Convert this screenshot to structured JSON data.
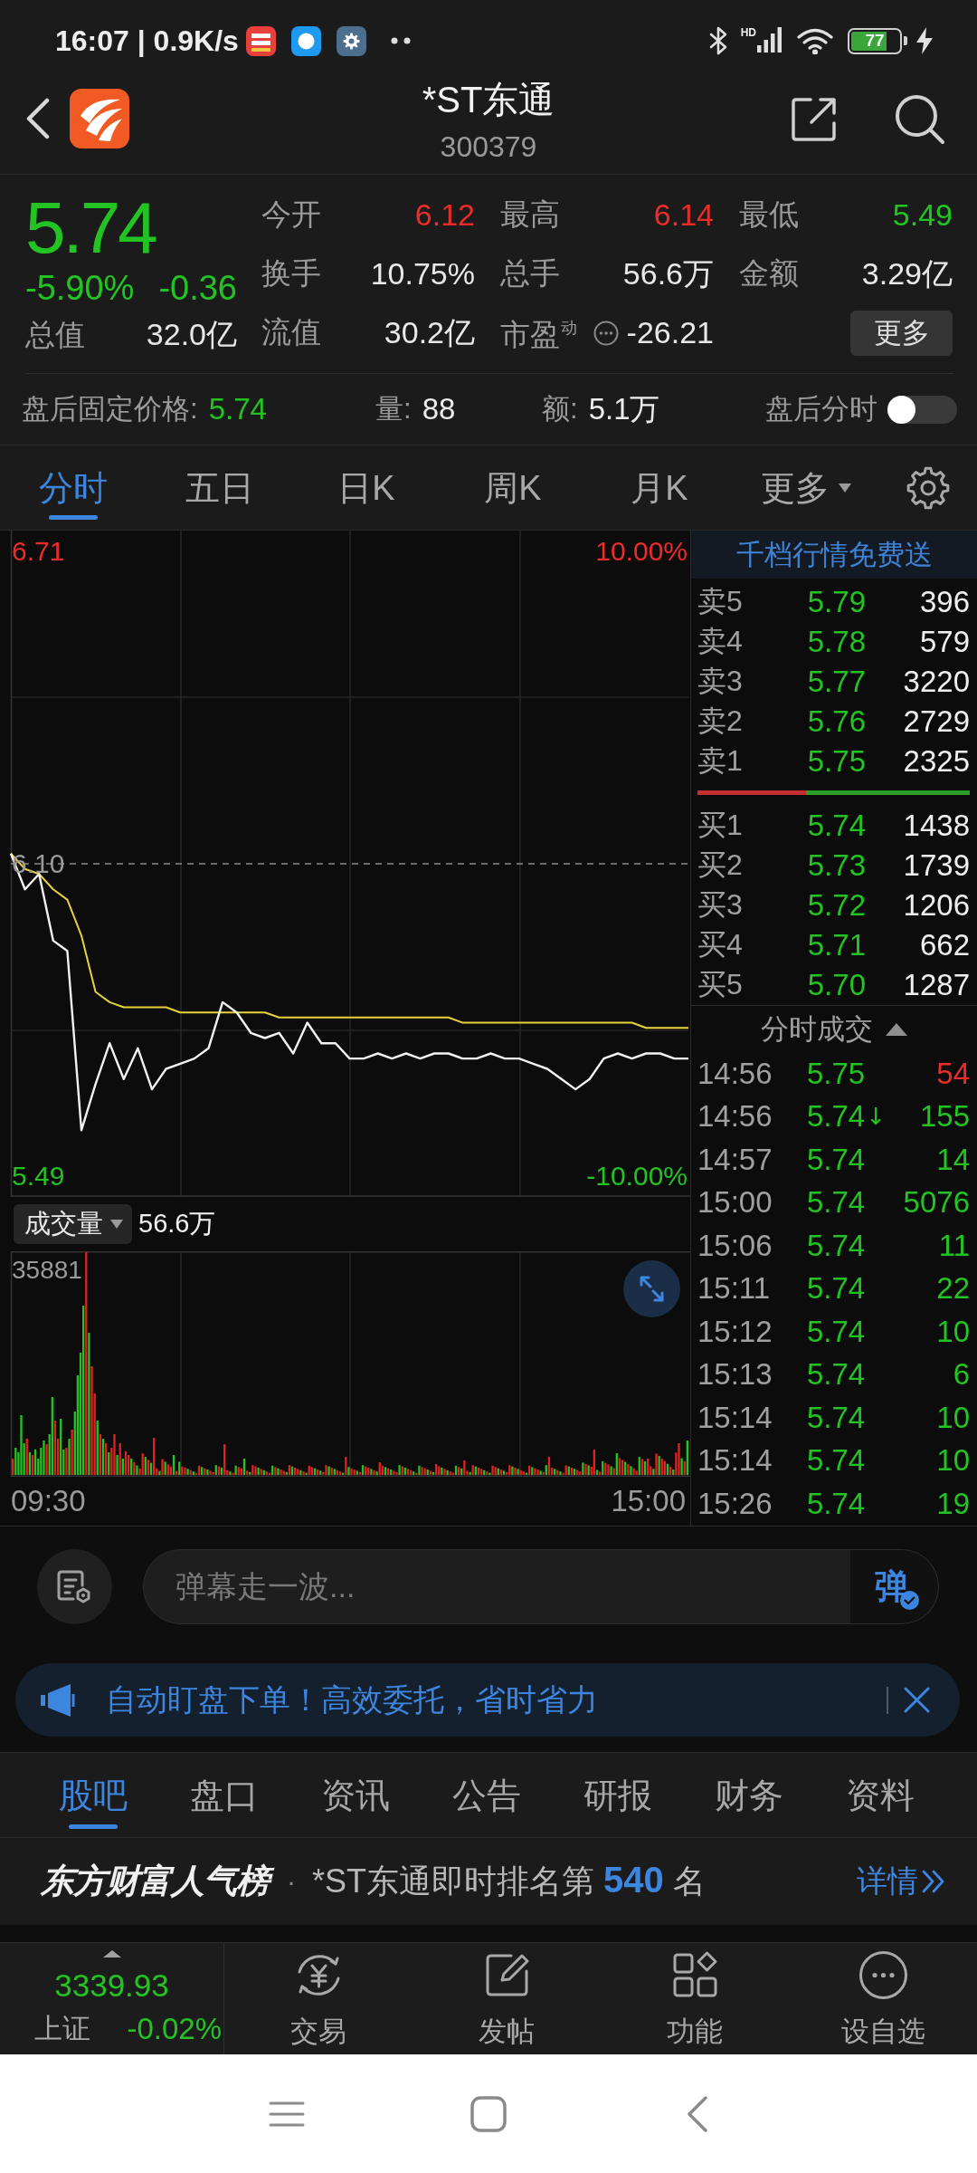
{
  "status_bar": {
    "time": "16:07 | 0.9K/s",
    "network_type": "HD",
    "battery": "77",
    "charging": true
  },
  "header": {
    "title": "*ST东通",
    "code": "300379"
  },
  "quote": {
    "price": "5.74",
    "change_percent": "-5.90%",
    "change": "-0.36",
    "color": "#22c322",
    "total_value": {
      "label": "总值",
      "value": "32.0亿"
    },
    "stats": [
      {
        "label": "今开",
        "value": "6.12",
        "color": "#ec2b2b",
        "kind": "plain"
      },
      {
        "label": "最高",
        "value": "6.14",
        "color": "#ec2b2b",
        "kind": "plain"
      },
      {
        "label": "最低",
        "value": "5.49",
        "color": "#22c322",
        "kind": "plain"
      },
      {
        "label": "换手",
        "value": "10.75%",
        "color": "#e8e8e8",
        "kind": "plain"
      },
      {
        "label": "总手",
        "value": "56.6万",
        "color": "#e8e8e8",
        "kind": "plain"
      },
      {
        "label": "金额",
        "value": "3.29亿",
        "color": "#e8e8e8",
        "kind": "plain"
      },
      {
        "label": "流值",
        "value": "30.2亿",
        "color": "#e8e8e8",
        "kind": "plain"
      },
      {
        "label": "市盈$^{动}$",
        "value": "-26.21",
        "color": "#e8e8e8",
        "kind": "info"
      }
    ],
    "more_button": "更多"
  },
  "after_hours": {
    "price_label": "盘后固定价格:",
    "price": {
      "value": "5.74",
      "color": "#22c322"
    },
    "volume_label": "量:",
    "volume": "88",
    "amount_label": "额:",
    "amount": "5.1万",
    "toggle_label": "盘后分时",
    "on": false
  },
  "chart_tabs": [
    {
      "label": "分时",
      "selected": true,
      "kind": "tab"
    },
    {
      "label": "五日",
      "selected": false,
      "kind": "tab"
    },
    {
      "label": "日K",
      "selected": false,
      "kind": "tab"
    },
    {
      "label": "周K",
      "selected": false,
      "kind": "tab"
    },
    {
      "label": "月K",
      "selected": false,
      "kind": "tab"
    },
    {
      "label": "更多",
      "selected": false,
      "kind": "menu"
    }
  ],
  "price_chart": {
    "change_labels": [
      "10.00%",
      "-10.00%"
    ],
    "chart_data": {
      "type": "line",
      "categories": [
        null,
        null,
        null,
        null,
        null,
        null,
        null,
        null,
        null,
        null,
        null,
        null,
        null,
        null,
        null,
        null,
        null,
        null,
        null,
        null,
        null,
        null,
        null,
        null,
        null,
        null,
        null,
        null,
        null,
        null,
        null,
        null,
        null,
        null,
        null,
        null,
        null,
        null,
        null,
        null,
        null,
        null,
        null,
        null,
        null,
        null,
        null,
        null,
        null
      ],
      "series": [
        {
          "color": "#f2f2f2",
          "values": [
            6.12,
            6.05,
            6.08,
            5.95,
            5.93,
            5.58,
            5.67,
            5.75,
            5.68,
            5.74,
            5.66,
            5.7,
            5.71,
            5.72,
            5.74,
            5.83,
            5.81,
            5.77,
            5.76,
            5.77,
            5.73,
            5.79,
            5.75,
            5.75,
            5.72,
            5.72,
            5.73,
            5.72,
            5.73,
            5.72,
            5.73,
            5.73,
            5.72,
            5.72,
            5.73,
            5.72,
            5.72,
            5.71,
            5.7,
            5.68,
            5.66,
            5.68,
            5.72,
            5.73,
            5.72,
            5.73,
            5.73,
            5.72,
            5.72
          ]
        },
        {
          "color": "#e6d23a",
          "values": [
            6.12,
            6.09,
            6.08,
            6.05,
            6.03,
            5.96,
            5.85,
            5.83,
            5.82,
            5.82,
            5.82,
            5.82,
            5.81,
            5.81,
            5.81,
            5.81,
            5.81,
            5.81,
            5.81,
            5.8,
            5.8,
            5.8,
            5.8,
            5.8,
            5.8,
            5.8,
            5.8,
            5.8,
            5.8,
            5.8,
            5.8,
            5.8,
            5.79,
            5.79,
            5.79,
            5.79,
            5.79,
            5.79,
            5.79,
            5.79,
            5.79,
            5.79,
            5.79,
            5.79,
            5.79,
            5.78,
            5.78,
            5.78,
            5.78
          ]
        }
      ],
      "ylim": [
        5.45,
        6.75
      ],
      "yticks": [
        {
          "value": 6.71,
          "label": "6.71"
        },
        {
          "value": 6.1,
          "label": "6.10"
        },
        {
          "value": 5.49,
          "label": "5.49"
        }
      ],
      "grid": true,
      "ref_lines": [
        {
          "axis": "y",
          "value": 6.1
        }
      ]
    }
  },
  "volume_chart": {
    "selector": "成交量",
    "total": "56.6万",
    "max_label": "35881",
    "time_labels": [
      "09:30",
      "15:00"
    ]
  },
  "order_book": {
    "promo": "千档行情免费送",
    "asks": [
      {
        "label": "卖5",
        "price": "5.79",
        "volume": "396",
        "color": "#22c322"
      },
      {
        "label": "卖4",
        "price": "5.78",
        "volume": "579",
        "color": "#22c322"
      },
      {
        "label": "卖3",
        "price": "5.77",
        "volume": "3220",
        "color": "#22c322"
      },
      {
        "label": "卖2",
        "price": "5.76",
        "volume": "2729",
        "color": "#22c322"
      },
      {
        "label": "卖1",
        "price": "5.75",
        "volume": "2325",
        "color": "#22c322"
      }
    ],
    "ratio_bar": {
      "level": 0.4
    },
    "bids": [
      {
        "label": "买1",
        "price": "5.74",
        "volume": "1438",
        "color": "#22c322"
      },
      {
        "label": "买2",
        "price": "5.73",
        "volume": "1739",
        "color": "#22c322"
      },
      {
        "label": "买3",
        "price": "5.72",
        "volume": "1206",
        "color": "#22c322"
      },
      {
        "label": "买4",
        "price": "5.71",
        "volume": "662",
        "color": "#22c322"
      },
      {
        "label": "买5",
        "price": "5.70",
        "volume": "1287",
        "color": "#22c322"
      }
    ]
  },
  "trades": {
    "title": "分时成交",
    "items": [
      {
        "time": "14:56",
        "price": {
          "value": "5.75",
          "color": "#22c322"
        },
        "volume": {
          "value": "54",
          "color": "#ec2b2b"
        }
      },
      {
        "time": "14:56",
        "price": {
          "value": "5.74",
          "color": "#22c322"
        },
        "marker": "↓",
        "volume": {
          "value": "155",
          "color": "#22c322"
        }
      },
      {
        "time": "14:57",
        "price": {
          "value": "5.74",
          "color": "#22c322"
        },
        "volume": {
          "value": "14",
          "color": "#22c322"
        }
      },
      {
        "time": "15:00",
        "price": {
          "value": "5.74",
          "color": "#22c322"
        },
        "volume": {
          "value": "5076",
          "color": "#22c322"
        }
      },
      {
        "time": "15:06",
        "price": {
          "value": "5.74",
          "color": "#22c322"
        },
        "volume": {
          "value": "11",
          "color": "#22c322"
        }
      },
      {
        "time": "15:11",
        "price": {
          "value": "5.74",
          "color": "#22c322"
        },
        "volume": {
          "value": "22",
          "color": "#22c322"
        }
      },
      {
        "time": "15:12",
        "price": {
          "value": "5.74",
          "color": "#22c322"
        },
        "volume": {
          "value": "10",
          "color": "#22c322"
        }
      },
      {
        "time": "15:13",
        "price": {
          "value": "5.74",
          "color": "#22c322"
        },
        "volume": {
          "value": "6",
          "color": "#22c322"
        }
      },
      {
        "time": "15:14",
        "price": {
          "value": "5.74",
          "color": "#22c322"
        },
        "volume": {
          "value": "10",
          "color": "#22c322"
        }
      },
      {
        "time": "15:14",
        "price": {
          "value": "5.74",
          "color": "#22c322"
        },
        "volume": {
          "value": "10",
          "color": "#22c322"
        }
      },
      {
        "time": "15:26",
        "price": {
          "value": "5.74",
          "color": "#22c322"
        },
        "volume": {
          "value": "19",
          "color": "#22c322"
        }
      }
    ]
  },
  "comment_bar": {
    "placeholder": "弹幕走一波...",
    "send": "弹"
  },
  "banner": {
    "text": "自动盯盘下单！高效委托，省时省力"
  },
  "info_tabs": [
    {
      "label": "股吧",
      "selected": true
    },
    {
      "label": "盘口",
      "selected": false
    },
    {
      "label": "资讯",
      "selected": false
    },
    {
      "label": "公告",
      "selected": false
    },
    {
      "label": "研报",
      "selected": false
    },
    {
      "label": "财务",
      "selected": false
    },
    {
      "label": "资料",
      "selected": false
    }
  ],
  "ranking": {
    "brand": "东方财富人气榜",
    "separator": "·",
    "text": "*ST东通即时排名第 **540** 名",
    "link": "详情"
  },
  "bottom_nav": {
    "index": {
      "value": "3339.93",
      "name": "上证",
      "change": "-0.02%",
      "color": "#22c322"
    },
    "items": [
      {
        "label": "交易"
      },
      {
        "label": "发帖"
      },
      {
        "label": "功能"
      },
      {
        "label": "设自选"
      }
    ]
  }
}
